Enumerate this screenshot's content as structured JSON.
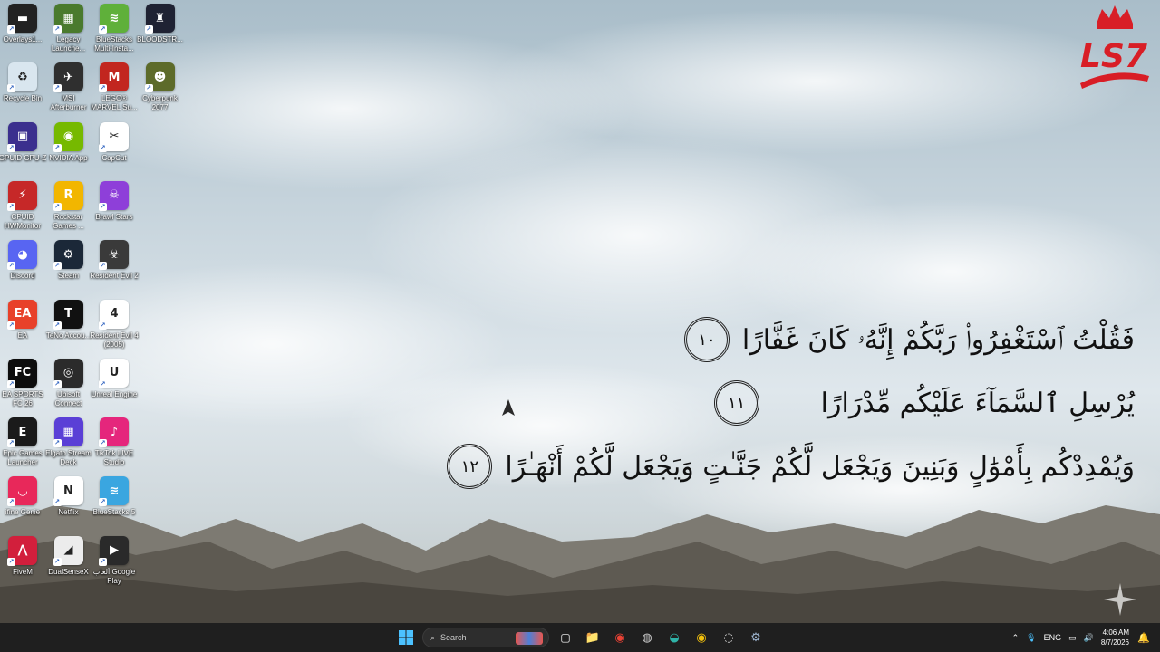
{
  "desktop": {
    "icons": [
      {
        "label": "Overlays1...",
        "color": "#222",
        "glyph": "▬",
        "col": 0,
        "row": 0
      },
      {
        "label": "Legacy Launche...",
        "color": "#4a7a2d",
        "glyph": "▦",
        "col": 1,
        "row": 0
      },
      {
        "label": "BlueStacks Multi-Insta...",
        "color": "#5fb03a",
        "glyph": "≋",
        "col": 2,
        "row": 0
      },
      {
        "label": "BLOODSTR...",
        "color": "#1f2233",
        "glyph": "♜",
        "col": 3,
        "row": 0
      },
      {
        "label": "Recycle Bin",
        "color": "#d9e6ef",
        "glyph": "♻",
        "col": 0,
        "row": 1
      },
      {
        "label": "MSI Afterburner",
        "color": "#2f2f2f",
        "glyph": "✈",
        "col": 1,
        "row": 1
      },
      {
        "label": "LEGO® MARVEL Su...",
        "color": "#c2261f",
        "glyph": "M",
        "col": 2,
        "row": 1
      },
      {
        "label": "Cyberpunk 2077",
        "color": "#5d6b2a",
        "glyph": "☻",
        "col": 3,
        "row": 1
      },
      {
        "label": "GPUID GPU-Z",
        "color": "#3b2f8e",
        "glyph": "▣",
        "col": 0,
        "row": 2
      },
      {
        "label": "NVIDIA App",
        "color": "#76b900",
        "glyph": "◉",
        "col": 1,
        "row": 2
      },
      {
        "label": "CapCut",
        "color": "#ffffff",
        "glyph": "✂",
        "col": 2,
        "row": 2
      },
      {
        "label": "CPUID HWMonitor",
        "color": "#c62828",
        "glyph": "⚡",
        "col": 0,
        "row": 3
      },
      {
        "label": "Rockstar Games ...",
        "color": "#f2b600",
        "glyph": "R",
        "col": 1,
        "row": 3
      },
      {
        "label": "Brawl Stars",
        "color": "#8e3fd9",
        "glyph": "☠",
        "col": 2,
        "row": 3
      },
      {
        "label": "Discord",
        "color": "#5865f2",
        "glyph": "◕",
        "col": 0,
        "row": 4
      },
      {
        "label": "Steam",
        "color": "#1b2838",
        "glyph": "⚙",
        "col": 1,
        "row": 4
      },
      {
        "label": "Resident Evil 2",
        "color": "#3a3a3a",
        "glyph": "☣",
        "col": 2,
        "row": 4
      },
      {
        "label": "EA",
        "color": "#e8412a",
        "glyph": "EA",
        "col": 0,
        "row": 5
      },
      {
        "label": "TeNo Accou...",
        "color": "#111111",
        "glyph": "T",
        "col": 1,
        "row": 5
      },
      {
        "label": "Resident Evil 4 (2005)",
        "color": "#ffffff",
        "glyph": "4",
        "col": 2,
        "row": 5
      },
      {
        "label": "EA SPORTS FC 26",
        "color": "#0d0d0d",
        "glyph": "FC",
        "col": 0,
        "row": 6
      },
      {
        "label": "Ubisoft Connect",
        "color": "#2b2b2b",
        "glyph": "◎",
        "col": 1,
        "row": 6
      },
      {
        "label": "Unreal Engine",
        "color": "#ffffff",
        "glyph": "U",
        "col": 2,
        "row": 6
      },
      {
        "label": "Epic Games Launcher",
        "color": "#1a1a1a",
        "glyph": "E",
        "col": 0,
        "row": 7
      },
      {
        "label": "Elgato Stream Deck",
        "color": "#5a3fd6",
        "glyph": "▦",
        "col": 1,
        "row": 7
      },
      {
        "label": "TikTok LIVE Studio",
        "color": "#e5267c",
        "glyph": "♪",
        "col": 2,
        "row": 7
      },
      {
        "label": "ifine Genie",
        "color": "#e8285a",
        "glyph": "◡",
        "col": 0,
        "row": 8
      },
      {
        "label": "Netflix",
        "color": "#ffffff",
        "glyph": "N",
        "col": 1,
        "row": 8
      },
      {
        "label": "BlueStacks 5",
        "color": "#3aa6e0",
        "glyph": "≋",
        "col": 2,
        "row": 8
      },
      {
        "label": "FiveM",
        "color": "#d21f3c",
        "glyph": "⋀",
        "col": 0,
        "row": 9
      },
      {
        "label": "DualSenseX",
        "color": "#ececec",
        "glyph": "◢",
        "col": 1,
        "row": 9
      },
      {
        "label": "ألعاب Google Play",
        "color": "#2a2a2a",
        "glyph": "▶",
        "col": 2,
        "row": 9
      }
    ]
  },
  "wallpaper": {
    "verses": [
      {
        "text": "فَقُلْتُ ٱسْتَغْفِرُوا۟ رَبَّكُمْ إِنَّهُۥ كَانَ غَفَّارًا",
        "number": "١٠"
      },
      {
        "text": "يُرْسِلِ ٱلسَّمَآءَ عَلَيْكُم مِّدْرَارًا",
        "number": "١١"
      },
      {
        "text": "وَيُمْدِدْكُم بِأَمْوَٰلٍ وَبَنِينَ وَيَجْعَل لَّكُمْ جَنَّـٰتٍ وَيَجْعَل لَّكُمْ أَنْهَـٰرًا",
        "number": "١٢"
      }
    ],
    "logo_text": "LS7"
  },
  "taskbar": {
    "search_placeholder": "Search",
    "pinned": [
      {
        "name": "file-explorer-icon",
        "glyph": "📁",
        "color": "#f2c94c"
      },
      {
        "name": "chrome-icon",
        "glyph": "◉",
        "color": "#e94235"
      },
      {
        "name": "app-icon",
        "glyph": "◍",
        "color": "#cfcfcf"
      },
      {
        "name": "edge-icon",
        "glyph": "◒",
        "color": "#2fb3a8"
      },
      {
        "name": "chrome-profile-icon",
        "glyph": "◉",
        "color": "#f4c20d"
      },
      {
        "name": "activity-icon",
        "glyph": "◌",
        "color": "#dddddd"
      },
      {
        "name": "steam-icon",
        "glyph": "⚙",
        "color": "#9fb6d1"
      }
    ],
    "tray": {
      "language": "ENG",
      "time": "4:06 AM",
      "date": "8/7/2026"
    }
  }
}
